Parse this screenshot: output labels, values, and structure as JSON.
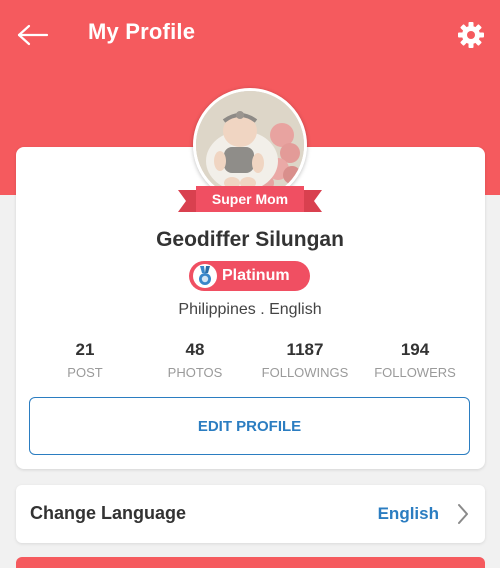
{
  "header": {
    "title": "My Profile",
    "back_icon": "arrow-left-icon",
    "settings_icon": "gear-icon",
    "color": "#f55a5e"
  },
  "profile": {
    "ribbon_label": "Super Mom",
    "name": "Geodiffer Silungan",
    "tier": "Platinum",
    "tier_icon": "medal-icon",
    "location": "Philippines . English",
    "stats": [
      {
        "value": "21",
        "label": "POST"
      },
      {
        "value": "48",
        "label": "PHOTOS"
      },
      {
        "value": "1187",
        "label": "FOLLOWINGS"
      },
      {
        "value": "194",
        "label": "FOLLOWERS"
      }
    ],
    "edit_button": "EDIT PROFILE"
  },
  "settings": {
    "language_title": "Change Language",
    "language_value": "English",
    "chevron_icon": "chevron-right-icon"
  },
  "colors": {
    "accent": "#f55a5e",
    "link_blue": "#2b7dc1",
    "badge_pink": "#f04f62"
  }
}
